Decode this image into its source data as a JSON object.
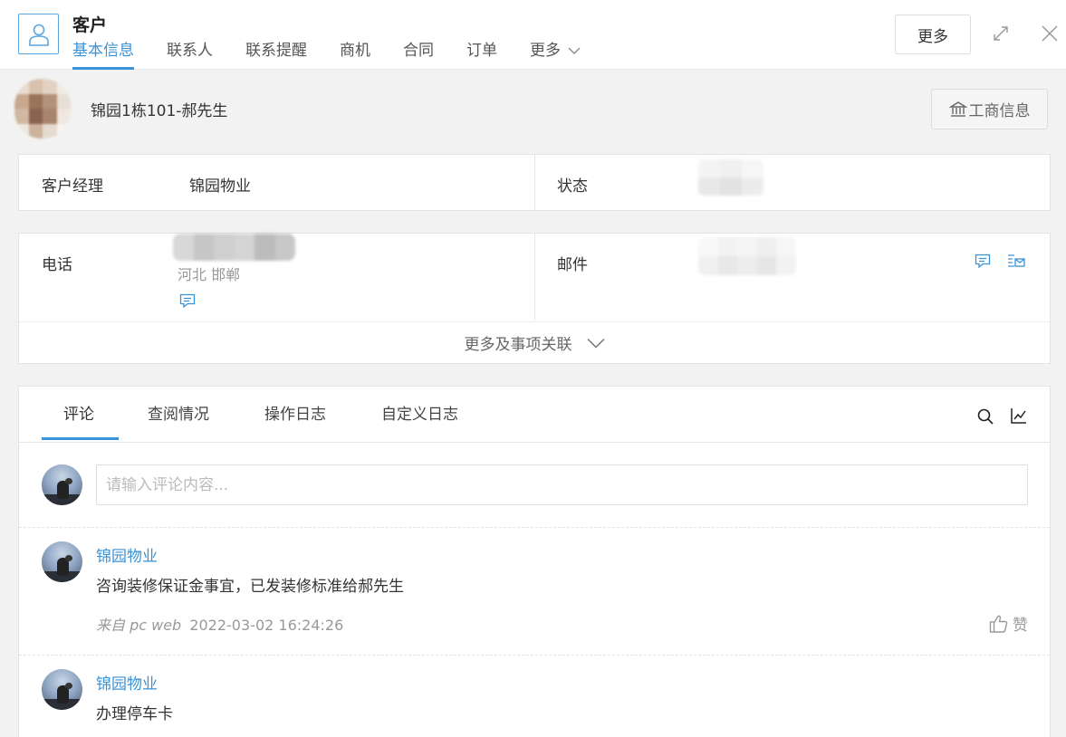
{
  "header": {
    "title": "客户",
    "tabs": [
      {
        "label": "基本信息",
        "active": true
      },
      {
        "label": "联系人"
      },
      {
        "label": "联系提醒"
      },
      {
        "label": "商机"
      },
      {
        "label": "合同"
      },
      {
        "label": "订单"
      },
      {
        "label": "更多"
      }
    ],
    "more_button": "更多"
  },
  "record": {
    "name": "锦园1栋101-郝先生",
    "biz_info_button": "工商信息"
  },
  "fields": {
    "manager_label": "客户经理",
    "manager_value": "锦园物业",
    "status_label": "状态",
    "phone_label": "电话",
    "phone_location": "河北 邯郸",
    "email_label": "邮件",
    "more_link": "更多及事项关联"
  },
  "comments": {
    "tabs": [
      "评论",
      "查阅情况",
      "操作日志",
      "自定义日志"
    ],
    "input_placeholder": "请输入评论内容...",
    "items": [
      {
        "author": "锦园物业",
        "text": "咨询装修保证金事宜，已发装修标准给郝先生",
        "source": "来自 pc web",
        "time": "2022-03-02 16:24:26",
        "like_label": "赞"
      },
      {
        "author": "锦园物业",
        "text": "办理停车卡"
      }
    ]
  },
  "colors": {
    "accent": "#3a93d6",
    "border": "#e3e3e3",
    "background": "#f2f2f2"
  },
  "icons": [
    "user-icon",
    "chevron-down-icon",
    "expand-icon",
    "close-icon",
    "bank-icon",
    "sms-icon",
    "email-icon",
    "search-icon",
    "chart-icon",
    "thumb-up-icon"
  ]
}
